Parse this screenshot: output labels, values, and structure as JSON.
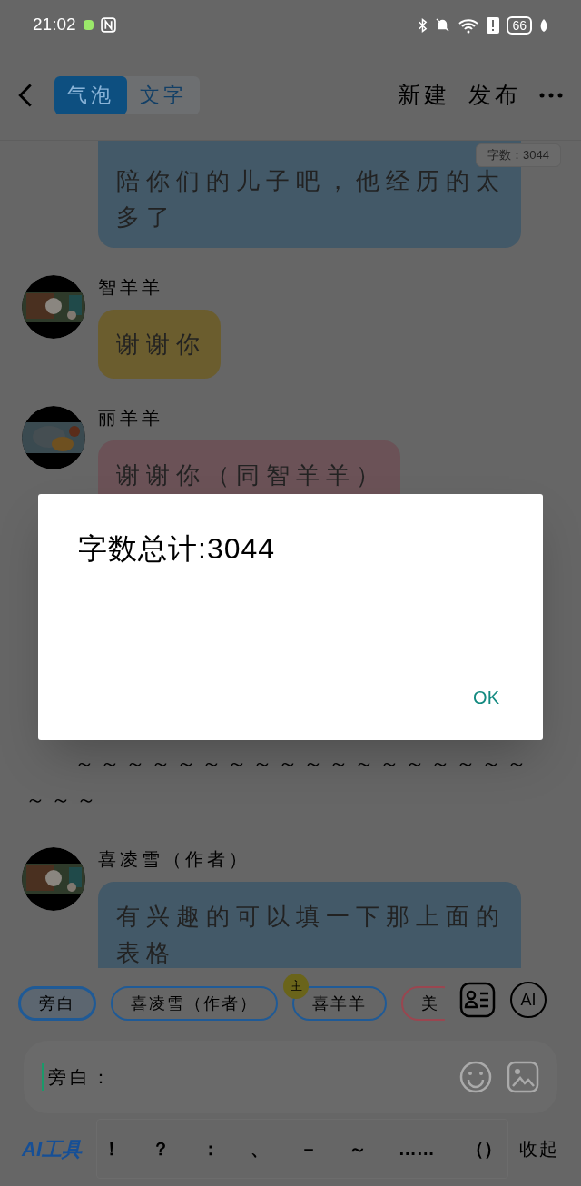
{
  "status_bar": {
    "time": "21:02",
    "battery": "66"
  },
  "header": {
    "tabs": [
      {
        "label": "气泡",
        "selected": true
      },
      {
        "label": "文字",
        "selected": false
      }
    ],
    "actions": [
      "新建",
      "发布"
    ]
  },
  "word_count_badge": "字数：3044",
  "messages": [
    {
      "kind": "continued",
      "text": "陪你们的儿子吧，他经历的太多了",
      "color": "#435968"
    },
    {
      "kind": "bubble",
      "speaker": "智羊羊",
      "text": "谢谢你",
      "color": "#6b5d2e"
    },
    {
      "kind": "bubble",
      "speaker": "丽羊羊",
      "text": "谢谢你（同智羊羊）",
      "color": "#6b5257"
    },
    {
      "kind": "narration",
      "text": "～～～～～～～～～～～～～～～～～～～～～"
    },
    {
      "kind": "bubble",
      "speaker": "喜凌雪（作者）",
      "text": "有兴趣的可以填一下那上面的表格",
      "color": "#435968"
    }
  ],
  "role_chips": [
    {
      "label": "旁白",
      "selected": true,
      "color": "#1f5a96"
    },
    {
      "label": "喜凌雪（作者）",
      "selected": false,
      "color": "#1f5a96"
    },
    {
      "label": "喜羊羊",
      "selected": false,
      "color": "#1f5a96",
      "badge": "主"
    },
    {
      "label": "美",
      "selected": false,
      "color": "#9a4650"
    }
  ],
  "ai_button": "AI",
  "input": {
    "value": "旁白："
  },
  "toolbar": {
    "ai_tools": "AI工具",
    "symbols": [
      "！",
      "？",
      "：",
      "、",
      "－",
      "～",
      "……",
      "（）"
    ],
    "collapse": "收起"
  },
  "dialog": {
    "message": "字数总计:3044",
    "button": "OK"
  }
}
